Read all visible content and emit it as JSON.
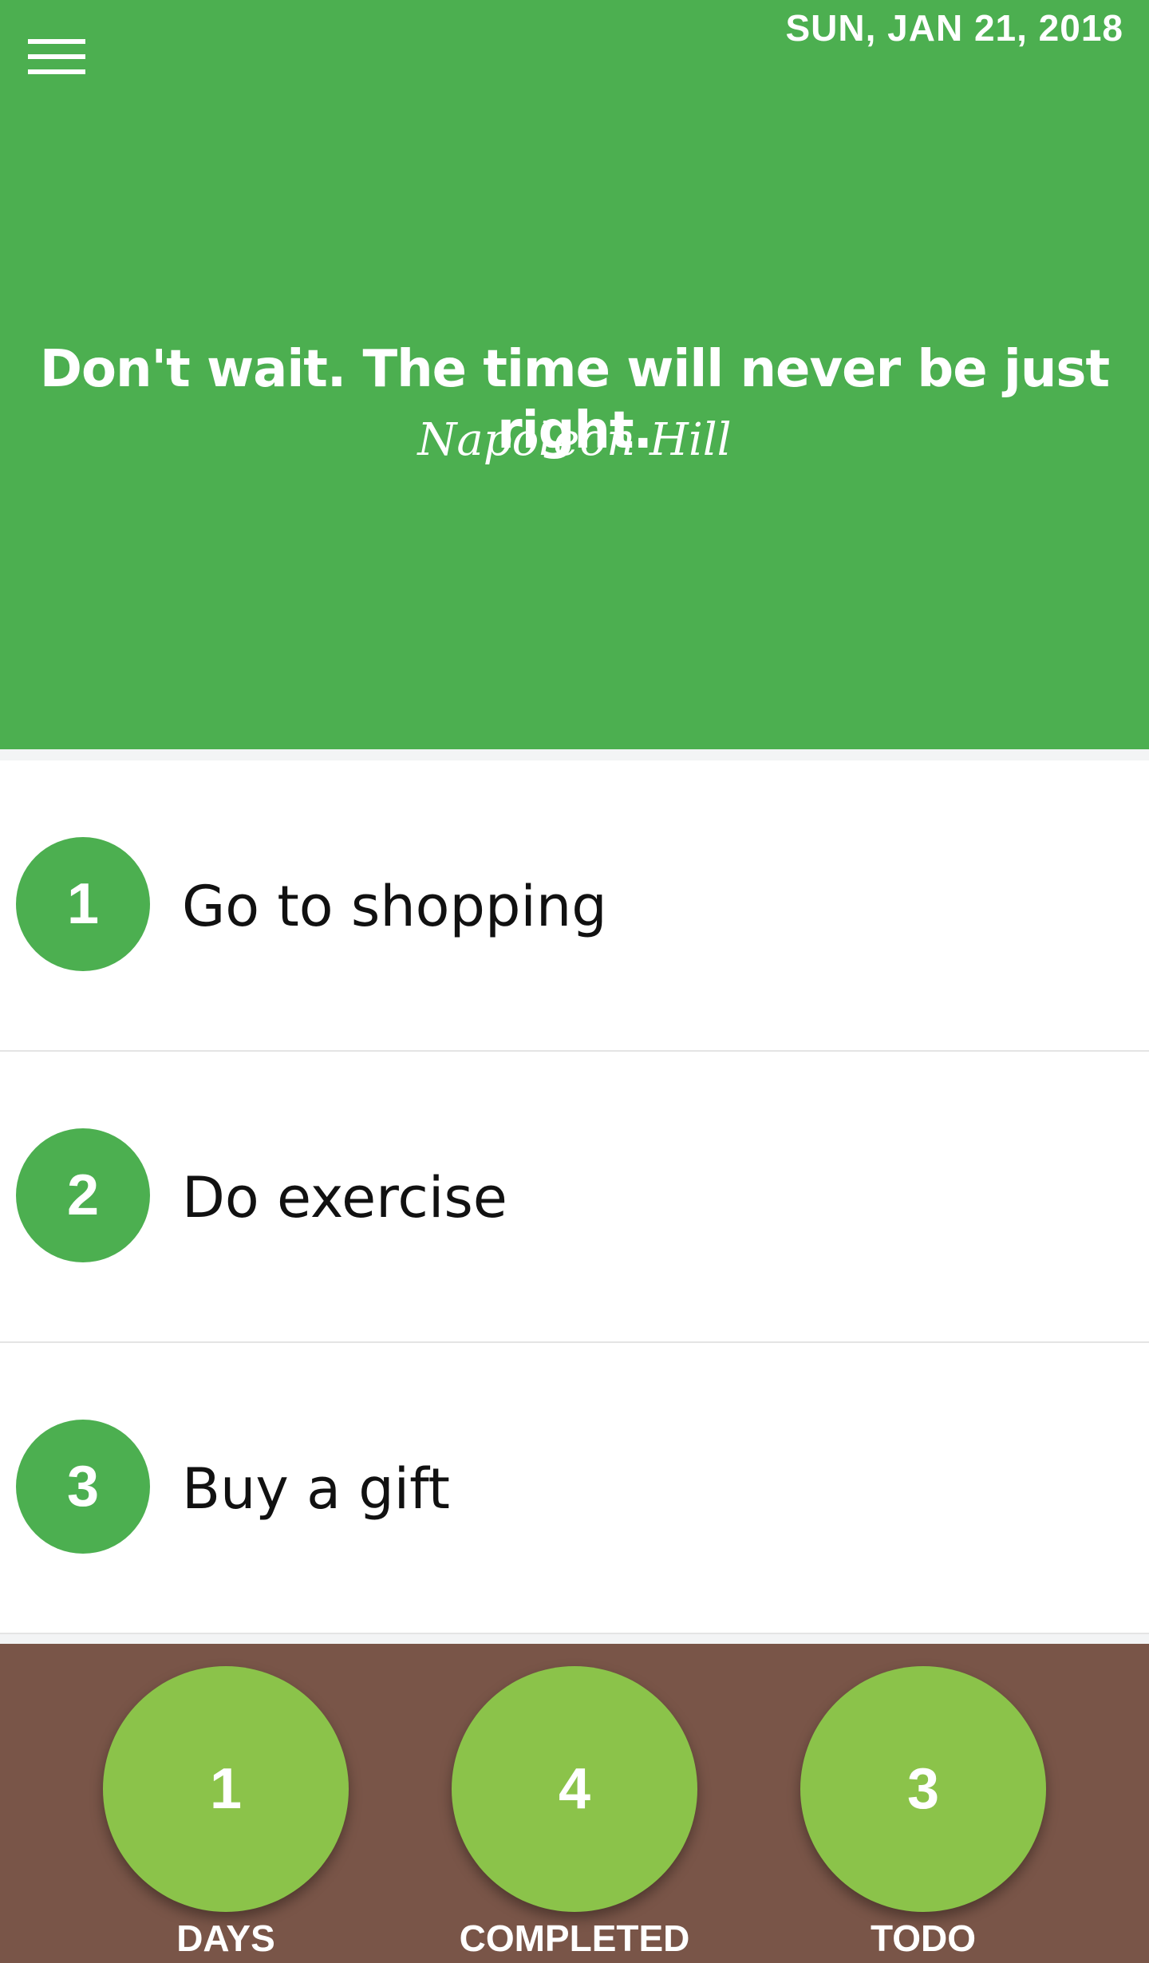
{
  "header": {
    "menu_icon": "hamburger-menu-icon",
    "date": "SUN, JAN 21, 2018",
    "quote": "Don't wait. The time will never be just right.",
    "author": "Napoleon Hill",
    "background_color": "#4caf50"
  },
  "tasks": [
    {
      "number": "1",
      "text": "Go to shopping"
    },
    {
      "number": "2",
      "text": "Do exercise"
    },
    {
      "number": "3",
      "text": "Buy a gift"
    }
  ],
  "stats": {
    "background_color": "#795548",
    "circle_color": "#8bc34a",
    "items": [
      {
        "value": "1",
        "label": "DAYS"
      },
      {
        "value": "4",
        "label": "COMPLETED"
      },
      {
        "value": "3",
        "label": "TODO"
      }
    ]
  }
}
